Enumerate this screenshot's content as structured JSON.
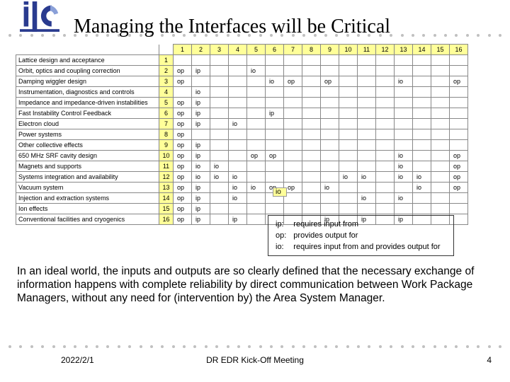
{
  "title": "Managing the Interfaces will be Critical",
  "rows": [
    {
      "label": "Lattice design and acceptance"
    },
    {
      "label": "Orbit, optics and coupling correction"
    },
    {
      "label": "Damping wiggler design"
    },
    {
      "label": "Instrumentation, diagnostics and controls"
    },
    {
      "label": "Impedance and impedance-driven instabilities"
    },
    {
      "label": "Fast Instability Control Feedback"
    },
    {
      "label": "Electron cloud"
    },
    {
      "label": "Power systems"
    },
    {
      "label": "Other collective effects"
    },
    {
      "label": "650 MHz SRF cavity design"
    },
    {
      "label": "Magnets and supports"
    },
    {
      "label": "Systems integration and availability"
    },
    {
      "label": "Vacuum system"
    },
    {
      "label": "Injection and extraction systems"
    },
    {
      "label": "Ion effects"
    },
    {
      "label": "Conventional facilities and cryogenics"
    }
  ],
  "matrix": [
    [
      "",
      "",
      "",
      "",
      "",
      "",
      "",
      "",
      "",
      "",
      "",
      "",
      "",
      "",
      "",
      ""
    ],
    [
      "op",
      "ip",
      "",
      "",
      "io",
      "",
      "",
      "",
      "",
      "",
      "",
      "",
      "",
      "",
      "",
      ""
    ],
    [
      "op",
      "",
      "",
      "",
      "",
      "io",
      "op",
      "",
      "op",
      "",
      "",
      "",
      "io",
      "",
      "",
      "op"
    ],
    [
      "",
      "io",
      "",
      "",
      "",
      "",
      "",
      "",
      "",
      "",
      "",
      "",
      "",
      "",
      "",
      ""
    ],
    [
      "op",
      "ip",
      "",
      "",
      "",
      "",
      "",
      "",
      "",
      "",
      "",
      "",
      "",
      "",
      "",
      ""
    ],
    [
      "op",
      "ip",
      "",
      "",
      "",
      "ip",
      "",
      "",
      "",
      "",
      "",
      "",
      "",
      "",
      "",
      ""
    ],
    [
      "op",
      "ip",
      "",
      "io",
      "",
      "",
      "",
      "",
      "",
      "",
      "",
      "",
      "",
      "",
      "",
      ""
    ],
    [
      "op",
      "",
      "",
      "",
      "",
      "",
      "",
      "",
      "",
      "",
      "",
      "",
      "",
      "",
      "",
      ""
    ],
    [
      "op",
      "ip",
      "",
      "",
      "",
      "",
      "",
      "",
      "",
      "",
      "",
      "",
      "",
      "",
      "",
      ""
    ],
    [
      "op",
      "ip",
      "",
      "",
      "op",
      "op",
      "",
      "",
      "",
      "",
      "",
      "",
      "io",
      "",
      "",
      "op"
    ],
    [
      "op",
      "io",
      "io",
      "",
      "",
      "",
      "",
      "",
      "",
      "",
      "",
      "",
      "io",
      "",
      "",
      "op"
    ],
    [
      "op",
      "io",
      "io",
      "io",
      "",
      "",
      "",
      "",
      "",
      "io",
      "io",
      "",
      "io",
      "io",
      "",
      "op"
    ],
    [
      "op",
      "ip",
      "",
      "io",
      "io",
      "op",
      "op",
      "",
      "io",
      "",
      "",
      "",
      "",
      "io",
      "",
      "op"
    ],
    [
      "op",
      "ip",
      "",
      "io",
      "",
      "",
      "",
      "",
      "",
      "",
      "io",
      "",
      "io",
      "",
      "",
      ""
    ],
    [
      "op",
      "ip",
      "",
      "",
      "",
      "",
      "",
      "",
      "",
      "",
      "",
      "",
      "",
      "",
      "",
      ""
    ],
    [
      "op",
      "ip",
      "",
      "ip",
      "",
      "",
      "",
      "",
      "ip",
      "",
      "ip",
      "",
      "ip",
      "",
      "",
      ""
    ]
  ],
  "highlight": "io",
  "legend": [
    {
      "k": "ip:",
      "v": "requires input from"
    },
    {
      "k": "op:",
      "v": "provides output for"
    },
    {
      "k": "io:",
      "v": "requires input from and provides output for"
    }
  ],
  "para": "In an ideal world, the inputs and outputs are so clearly defined that the necessary exchange of information happens with complete reliability by direct communication between Work Package Managers, without any need for (intervention by) the Area System Manager.",
  "footer": {
    "date": "2022/2/1",
    "title": "DR EDR Kick-Off Meeting",
    "num": "4"
  },
  "chart_data": {
    "type": "table",
    "title": "Managing the Interfaces will be Critical",
    "row_headers": [
      "Lattice design and acceptance",
      "Orbit, optics and coupling correction",
      "Damping wiggler design",
      "Instrumentation, diagnostics and controls",
      "Impedance and impedance-driven instabilities",
      "Fast Instability Control Feedback",
      "Electron cloud",
      "Power systems",
      "Other collective effects",
      "650 MHz SRF cavity design",
      "Magnets and supports",
      "Systems integration and availability",
      "Vacuum system",
      "Injection and extraction systems",
      "Ion effects",
      "Conventional facilities and cryogenics"
    ],
    "column_headers": [
      "1",
      "2",
      "3",
      "4",
      "5",
      "6",
      "7",
      "8",
      "9",
      "10",
      "11",
      "12",
      "13",
      "14",
      "15",
      "16"
    ],
    "values": [
      [
        "",
        "",
        "",
        "",
        "",
        "",
        "",
        "",
        "",
        "",
        "",
        "",
        "",
        "",
        "",
        ""
      ],
      [
        "op",
        "ip",
        "",
        "",
        "io",
        "",
        "",
        "",
        "",
        "",
        "",
        "",
        "",
        "",
        "",
        ""
      ],
      [
        "op",
        "",
        "",
        "",
        "",
        "io",
        "op",
        "",
        "op",
        "",
        "",
        "",
        "io",
        "",
        "",
        "op"
      ],
      [
        "",
        "io",
        "",
        "",
        "",
        "",
        "",
        "",
        "",
        "",
        "",
        "",
        "",
        "",
        "",
        ""
      ],
      [
        "op",
        "ip",
        "",
        "",
        "",
        "",
        "",
        "",
        "",
        "",
        "",
        "",
        "",
        "",
        "",
        ""
      ],
      [
        "op",
        "ip",
        "",
        "",
        "",
        "ip",
        "",
        "",
        "",
        "",
        "",
        "",
        "",
        "",
        "",
        ""
      ],
      [
        "op",
        "ip",
        "",
        "io",
        "",
        "",
        "",
        "",
        "",
        "",
        "",
        "",
        "",
        "",
        "",
        ""
      ],
      [
        "op",
        "",
        "",
        "",
        "",
        "",
        "",
        "",
        "",
        "",
        "",
        "",
        "",
        "",
        "",
        ""
      ],
      [
        "op",
        "ip",
        "",
        "",
        "",
        "",
        "",
        "",
        "",
        "",
        "",
        "",
        "",
        "",
        "",
        ""
      ],
      [
        "op",
        "ip",
        "",
        "",
        "op",
        "op",
        "",
        "",
        "",
        "",
        "",
        "",
        "io",
        "",
        "",
        "op"
      ],
      [
        "op",
        "io",
        "io",
        "",
        "",
        "",
        "",
        "",
        "",
        "",
        "",
        "",
        "io",
        "",
        "",
        "op"
      ],
      [
        "op",
        "io",
        "io",
        "io",
        "",
        "",
        "",
        "",
        "",
        "io",
        "io",
        "",
        "io",
        "io",
        "",
        "op"
      ],
      [
        "op",
        "ip",
        "",
        "io",
        "io",
        "op",
        "op",
        "",
        "io",
        "",
        "",
        "",
        "",
        "io",
        "",
        "op"
      ],
      [
        "op",
        "ip",
        "",
        "io",
        "",
        "",
        "",
        "",
        "",
        "",
        "io",
        "",
        "io",
        "",
        "",
        ""
      ],
      [
        "op",
        "ip",
        "",
        "",
        "",
        "",
        "",
        "",
        "",
        "",
        "",
        "",
        "",
        "",
        "",
        ""
      ],
      [
        "op",
        "ip",
        "",
        "ip",
        "",
        "",
        "",
        "",
        "ip",
        "",
        "ip",
        "",
        "ip",
        "",
        "",
        ""
      ]
    ],
    "legend": {
      "ip": "requires input from",
      "op": "provides output for",
      "io": "requires input from and provides output for"
    }
  }
}
